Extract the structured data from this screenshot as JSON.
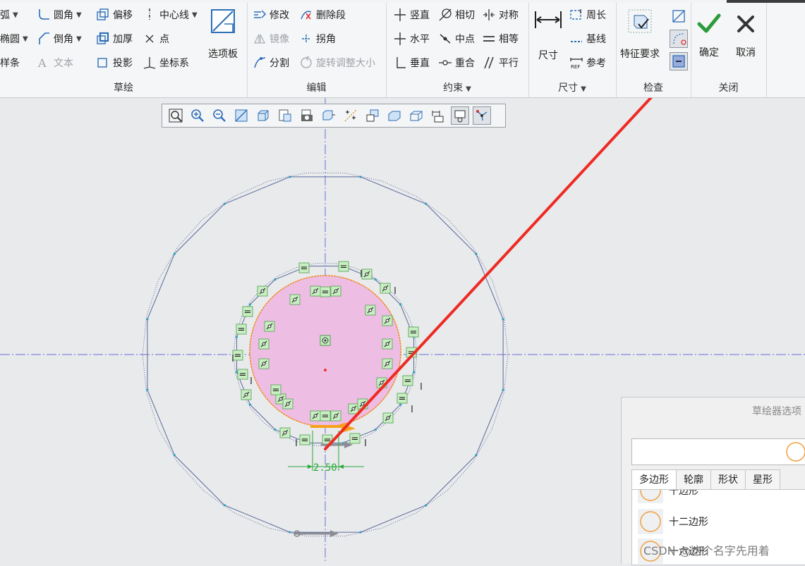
{
  "ribbon": {
    "groups": {
      "sketch": {
        "label": "草绘",
        "items": {
          "arc": "弧",
          "fillet": "圆角",
          "offset": "偏移",
          "centerline": "中心线",
          "ellipse": "椭圆",
          "chamfer": "倒角",
          "thicken": "加厚",
          "point": "点",
          "spline": "样条",
          "text": "文本",
          "project": "投影",
          "coordsys": "坐标系",
          "palette": "选项板"
        }
      },
      "edit": {
        "label": "编辑",
        "items": {
          "modify": "修改",
          "delete_segment": "删除段",
          "mirror": "镜像",
          "corner": "拐角",
          "divide": "分割",
          "rotate_resize": "旋转调整大小"
        }
      },
      "constrain": {
        "label": "约束",
        "items": {
          "vertical": "竖直",
          "tangent": "相切",
          "symmetric": "对称",
          "horizontal": "水平",
          "midpoint": "中点",
          "equal": "相等",
          "perpendicular": "垂直",
          "coincident": "重合",
          "parallel": "平行"
        }
      },
      "dimension": {
        "label": "尺寸",
        "items": {
          "dimension": "尺寸",
          "perimeter": "周长",
          "baseline": "基线",
          "reference": "参考"
        }
      },
      "inspect": {
        "label": "检查",
        "items": {
          "feature_requirements": "特征要求"
        }
      },
      "close": {
        "label": "关闭",
        "items": {
          "ok": "确定",
          "cancel": "取消"
        }
      }
    }
  },
  "sketch_canvas": {
    "dimension_value": "2.50",
    "constraint_symbol": "="
  },
  "palette_panel": {
    "title": "草绘器选项",
    "tabs": [
      "多边形",
      "轮廓",
      "形状",
      "星形"
    ],
    "items": [
      "十边形",
      "十二边形",
      "十六边形"
    ]
  },
  "watermark": "CSDN @这个名字先用着",
  "colors": {
    "arrow": "#ee2a24",
    "ok_green": "#2b9a3b",
    "fill_pink": "#eebde4",
    "constraint_bg": "#c8efc1"
  }
}
